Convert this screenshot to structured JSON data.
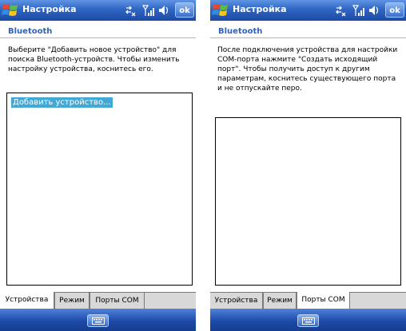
{
  "screens": [
    {
      "app_title": "Настройка",
      "ok_label": "ok",
      "section_title": "Bluetooth",
      "instructions": "Выберите \"Добавить новое устройство\" для поиска Bluetooth-устройств. Чтобы изменить настройку устройства, коснитесь его.",
      "list_items": [
        "Добавить устройство..."
      ],
      "tabs": [
        {
          "label": "Устройства",
          "active": true
        },
        {
          "label": "Режим",
          "active": false
        },
        {
          "label": "Порты COM",
          "active": false
        }
      ]
    },
    {
      "app_title": "Настройка",
      "ok_label": "ok",
      "section_title": "Bluetooth",
      "instructions": "После подключения устройства для настройки COM-порта нажмите \"Создать исходящий порт\". Чтобы получить доступ к другим параметрам, коснитесь существующего порта и не отпускайте перо.",
      "list_items": [],
      "tabs": [
        {
          "label": "Устройства",
          "active": false
        },
        {
          "label": "Режим",
          "active": false
        },
        {
          "label": "Порты COM",
          "active": true
        }
      ]
    }
  ],
  "colors": {
    "titlebar": "#2f66c4",
    "section_title": "#2b63c0",
    "selection": "#42a8d6"
  },
  "icons": [
    "windows-start-icon",
    "connectivity-icon",
    "signal-strength-icon",
    "volume-icon",
    "keyboard-icon"
  ]
}
